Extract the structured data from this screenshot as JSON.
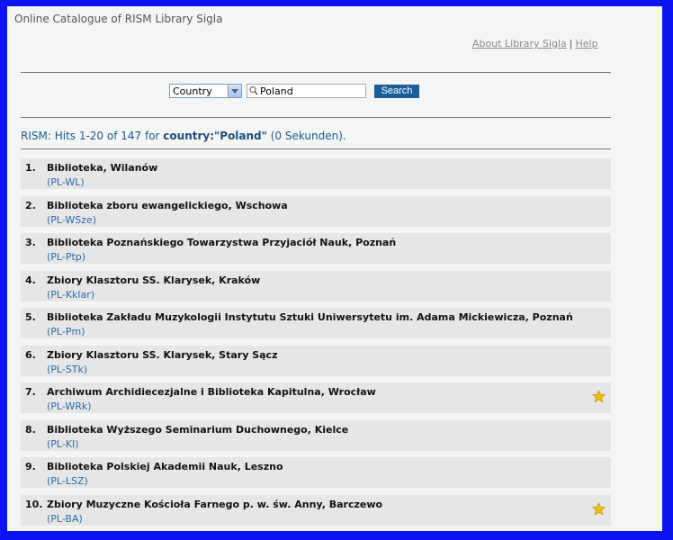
{
  "header": {
    "title": "Online Catalogue of RISM Library Sigla"
  },
  "links": {
    "about": "About Library Sigla",
    "separator": "|",
    "help": "Help"
  },
  "search": {
    "field_selected": "Country",
    "query": "Poland",
    "button": "Search"
  },
  "summary": {
    "prefix": "RISM: Hits 1-20 of 147 for ",
    "query": "country:\"Poland\"",
    "suffix": " (0 Sekunden)."
  },
  "results": [
    {
      "num": "1.",
      "name": "Biblioteka, Wilanów",
      "siglum": "(PL-WL)",
      "starred": false
    },
    {
      "num": "2.",
      "name": "Biblioteka zboru ewangelickiego, Wschowa",
      "siglum": "(PL-WSze)",
      "starred": false
    },
    {
      "num": "3.",
      "name": "Biblioteka Poznańskiego Towarzystwa Przyjaciół Nauk, Poznań",
      "siglum": "(PL-Ptp)",
      "starred": false
    },
    {
      "num": "4.",
      "name": "Zbiory Klasztoru SS. Klarysek, Kraków",
      "siglum": "(PL-Kklar)",
      "starred": false
    },
    {
      "num": "5.",
      "name": "Biblioteka Zakładu Muzykologii Instytutu Sztuki Uniwersytetu im. Adama Mickiewicza, Poznań",
      "siglum": "(PL-Pm)",
      "starred": false
    },
    {
      "num": "6.",
      "name": "Zbiory Klasztoru SS. Klarysek, Stary Sącz",
      "siglum": "(PL-STk)",
      "starred": false
    },
    {
      "num": "7.",
      "name": "Archiwum Archidiecezjalne i Biblioteka Kapitulna, Wrocław",
      "siglum": "(PL-WRk)",
      "starred": true
    },
    {
      "num": "8.",
      "name": "Biblioteka Wyższego Seminarium Duchownego, Kielce",
      "siglum": "(PL-KI)",
      "starred": false
    },
    {
      "num": "9.",
      "name": "Biblioteka Polskiej Akademii Nauk, Leszno",
      "siglum": "(PL-LSZ)",
      "starred": false
    },
    {
      "num": "10.",
      "name": "Zbiory Muzyczne Kościoła Farnego p. w. św. Anny, Barczewo",
      "siglum": "(PL-BA)",
      "starred": true
    }
  ],
  "colors": {
    "border": "#0a14f0",
    "link": "#2c6aa6",
    "button": "#1a5f9a",
    "star": "#f0c000"
  },
  "icons": {
    "search": "magnifier-icon",
    "dropdown": "chevron-down-icon",
    "favorite": "star-icon"
  }
}
